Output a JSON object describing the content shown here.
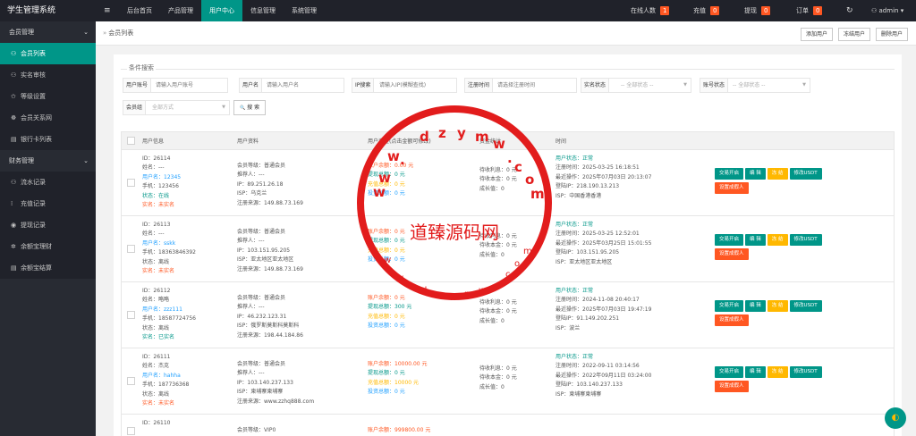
{
  "brand": "学生管理系统",
  "menu_toggle_icon": "≡",
  "nav": [
    "后台首页",
    "产品管理",
    "用户中心",
    "信息管理",
    "系统管理"
  ],
  "nav_active": 2,
  "top_right": {
    "online": "在线人数",
    "online_count": "1",
    "recharge": "充值",
    "recharge_count": "0",
    "withdraw": "提现",
    "withdraw_count": "0",
    "orders": "订单",
    "orders_count": "0",
    "refresh_icon": "↻",
    "user_icon": "⚇",
    "user": "admin",
    "user_arrow": "▾"
  },
  "sidebar": {
    "groups": [
      {
        "label": "会员管理",
        "chev": "⌄",
        "items": [
          {
            "icon": "⚇",
            "label": "会员列表"
          },
          {
            "icon": "⚇",
            "label": "实名审核"
          },
          {
            "icon": "✩",
            "label": "等级设置"
          },
          {
            "icon": "☸",
            "label": "会员关系网"
          },
          {
            "icon": "▤",
            "label": "银行卡列表"
          }
        ]
      },
      {
        "label": "财务管理",
        "chev": "⌄",
        "items": [
          {
            "icon": "⚇",
            "label": "流水记录"
          },
          {
            "icon": "⁞",
            "label": "充值记录"
          },
          {
            "icon": "◉",
            "label": "提现记录"
          },
          {
            "icon": "✲",
            "label": "余额宝理财"
          },
          {
            "icon": "▤",
            "label": "余额宝结算"
          }
        ]
      }
    ]
  },
  "crumb": {
    "arrow": "»",
    "label": "会员列表"
  },
  "toolbar": {
    "add": "添加用户",
    "freeze": "冻结用户",
    "delete": "删除用户"
  },
  "search": {
    "legend": "条件搜索",
    "account_label": "用户账号",
    "account_ph": "请输入用户账号",
    "name_label": "用户名",
    "name_ph": "请输入用户名",
    "ip_label": "IP搜索",
    "ip_ph": "请输入IP(模糊查找)",
    "regtime_label": "注册时间",
    "regtime_ph": "请选择注册时间",
    "real_label": "实名状态",
    "real_ph": "-- 全部状态 --",
    "acct_status_label": "账号状态",
    "acct_status_ph": "-- 全部状态 --",
    "group_label": "会员组",
    "group_ph": "全部方式",
    "search_icon": "🔍",
    "search_btn": "搜 索"
  },
  "table": {
    "headers": [
      "用户信息",
      "用户资料",
      "用户资金(点击金额可修改)",
      "资金统计",
      "时间"
    ],
    "rows": [
      {
        "info": [
          "ID：26114",
          "姓名：---",
          "用户名：12345",
          "手机：123456",
          "状态：在线",
          "实名：未实名"
        ],
        "profile": [
          "会员等级：普通会员",
          "推荐人：---",
          "IP：89.251.26.18",
          "ISP：乌克兰",
          "注册来源：149.88.73.169"
        ],
        "money": [
          "账户余额：0.00 元",
          "提现总额：0 元",
          "充值总额：0 元",
          "投资总额：0 元"
        ],
        "stats": [
          "待收利息：0 元",
          "待收本金：0 元",
          "成长值：0"
        ],
        "time": [
          "用户状态：正常",
          "注册时间：2025-03-25 16:18:51",
          "最近操作：2025年07月03日 20:13:07",
          "登陆IP：218.190.13.213",
          "ISP：中国香港香港"
        ]
      },
      {
        "info": [
          "ID：26113",
          "姓名：---",
          "用户名：sskk",
          "手机：18363846392",
          "状态：离线",
          "实名：未实名"
        ],
        "profile": [
          "会员等级：普通会员",
          "推荐人：---",
          "IP：103.151.95.205",
          "ISP：亚太地区亚太地区",
          "注册来源：149.88.73.169"
        ],
        "money": [
          "账户余额：0 元",
          "提现总额：0 元",
          "充值总额：0 元",
          "投资总额：0 元"
        ],
        "stats": [
          "待收利息：0 元",
          "待收本金：0 元",
          "成长值：0"
        ],
        "time": [
          "用户状态：正常",
          "注册时间：2025-03-25 12:52:01",
          "最近操作：2025年03月25日 15:01:55",
          "登陆IP：103.151.95.205",
          "ISP：亚太地区亚太地区"
        ]
      },
      {
        "info": [
          "ID：26112",
          "姓名：略略",
          "用户名：zzz111",
          "手机：18587724756",
          "状态：离线",
          "实名：已实名"
        ],
        "profile": [
          "会员等级：普通会员",
          "推荐人：---",
          "IP：46.232.123.31",
          "ISP：俄罗斯莫斯科莫斯科",
          "注册来源：198.44.184.86"
        ],
        "money": [
          "账户余额：0 元",
          "提现总额：300 元",
          "充值总额：0 元",
          "投资总额：0 元"
        ],
        "stats": [
          "待收利息：0 元",
          "待收本金：0 元",
          "成长值：0"
        ],
        "time": [
          "用户状态：正常",
          "注册时间：2024-11-08 20:40:17",
          "最近操作：2025年07月03日 19:47:19",
          "登陆IP：91.149.202.251",
          "ISP：波兰"
        ]
      },
      {
        "info": [
          "ID：26111",
          "姓名：杰克",
          "用户名：hahha",
          "手机：187736368",
          "状态：离线",
          "实名：未实名"
        ],
        "profile": [
          "会员等级：普通会员",
          "推荐人：---",
          "IP：103.140.237.133",
          "ISP：柬埔寨柬埔寨",
          "注册来源：www.zzhq888.com"
        ],
        "money": [
          "账户余额：10000.00 元",
          "提现总额：0 元",
          "充值总额：10000 元",
          "投资总额：0 元"
        ],
        "stats": [
          "待收利息：0 元",
          "待收本金：0 元",
          "成长值：0"
        ],
        "time": [
          "用户状态：正常",
          "注册时间：2022-09-11 03:14:56",
          "最近操作：2022年09月11日 03:24:00",
          "登陆IP：103.140.237.133",
          "ISP：柬埔寨柬埔寨"
        ]
      },
      {
        "info": [
          "ID：26110"
        ],
        "profile": [
          "会员等级：VIP0"
        ],
        "money": [
          "账户余额：999800.00 元"
        ],
        "stats": [],
        "time": []
      }
    ],
    "actions": {
      "trade": "交易开启",
      "edit": "编 辑",
      "freeze": "冻 结",
      "usdt": "修改USDT",
      "fake": "设置成假人"
    }
  },
  "watermark": {
    "main": "道臻源码网",
    "chars": [
      "d",
      "z",
      "y",
      "m",
      "w",
      ".",
      "c",
      "o",
      "m",
      "w",
      ".",
      "w",
      "w",
      "w",
      "w",
      "d",
      "z",
      "y",
      "m",
      "w",
      ".",
      "c",
      "o",
      "m"
    ]
  },
  "float_icon": "◐"
}
